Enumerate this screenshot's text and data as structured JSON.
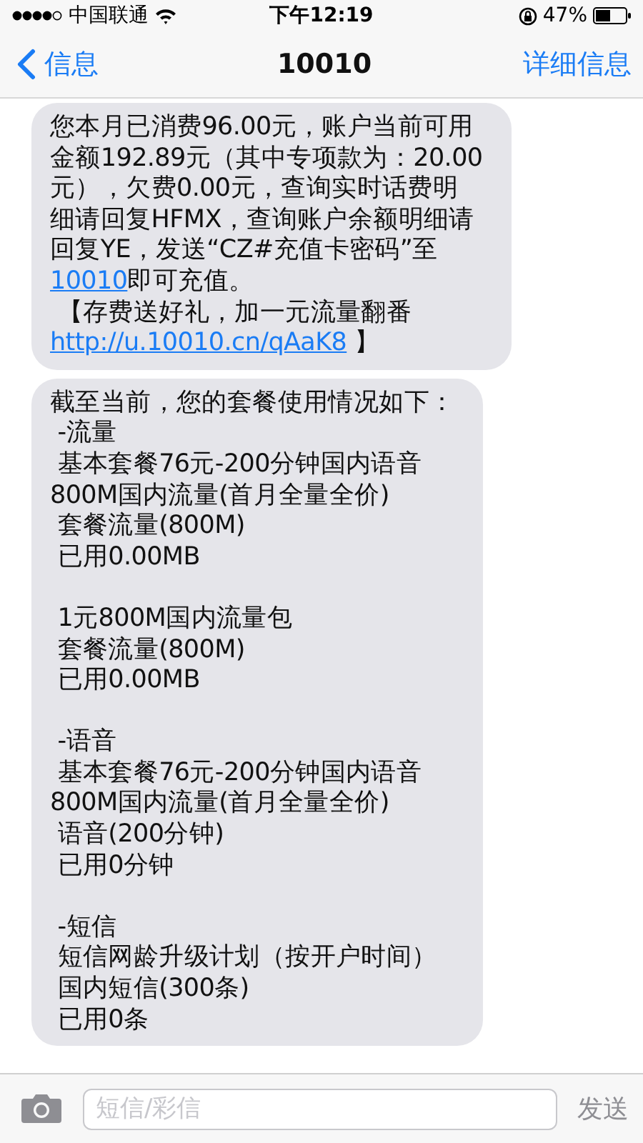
{
  "status_bar": {
    "carrier": "中国联通",
    "time": "下午12:19",
    "battery": "47%"
  },
  "nav": {
    "back": "信息",
    "title": "10010",
    "details": "详细信息"
  },
  "messages": [
    {
      "kind": "received",
      "paragraphs": [
        {
          "lines": [
            [
              {
                "kind": "text",
                "text": "您本月已消费96.00元，账户当前可用"
              }
            ],
            [
              {
                "kind": "text",
                "text": "金额192.89元（其中专项款为：20.00"
              }
            ],
            [
              {
                "kind": "text",
                "text": "元），欠费0.00元，查询实时话费明"
              }
            ],
            [
              {
                "kind": "text",
                "text": "细请回复HFMX，查询账户余额明细请"
              }
            ],
            [
              {
                "kind": "text",
                "text": "回复YE，发送“CZ#充值卡密码”至"
              }
            ],
            [
              {
                "kind": "link",
                "text": "10010"
              },
              {
                "kind": "text",
                "text": "即可充值。"
              }
            ],
            [
              {
                "kind": "text",
                "text": " 【存费送好礼，加一元流量翻番"
              }
            ],
            [
              {
                "kind": "link",
                "text": "http://u.10010.cn/qAaK8"
              },
              {
                "kind": "text",
                "text": " 】"
              }
            ]
          ]
        }
      ]
    },
    {
      "kind": "received",
      "paragraphs": [
        {
          "lines": [
            [
              {
                "kind": "text",
                "text": "截至当前，您的套餐使用情况如下："
              }
            ],
            [
              {
                "kind": "text",
                "text": " -流量"
              }
            ],
            [
              {
                "kind": "text",
                "text": " 基本套餐76元-200分钟国内语音"
              }
            ],
            [
              {
                "kind": "text",
                "text": "800M国内流量(首月全量全价)"
              }
            ],
            [
              {
                "kind": "text",
                "text": " 套餐流量(800M)"
              }
            ],
            [
              {
                "kind": "text",
                "text": " 已用0.00MB"
              }
            ]
          ]
        },
        {
          "lines": [
            [
              {
                "kind": "text",
                "text": " 1元800M国内流量包"
              }
            ],
            [
              {
                "kind": "text",
                "text": " 套餐流量(800M)"
              }
            ],
            [
              {
                "kind": "text",
                "text": " 已用0.00MB"
              }
            ]
          ]
        },
        {
          "lines": [
            [
              {
                "kind": "text",
                "text": " -语音"
              }
            ],
            [
              {
                "kind": "text",
                "text": " 基本套餐76元-200分钟国内语音"
              }
            ],
            [
              {
                "kind": "text",
                "text": "800M国内流量(首月全量全价)"
              }
            ],
            [
              {
                "kind": "text",
                "text": " 语音(200分钟)"
              }
            ],
            [
              {
                "kind": "text",
                "text": " 已用0分钟"
              }
            ]
          ]
        },
        {
          "lines": [
            [
              {
                "kind": "text",
                "text": " -短信"
              }
            ],
            [
              {
                "kind": "text",
                "text": " 短信网龄升级计划（按开户时间）"
              }
            ],
            [
              {
                "kind": "text",
                "text": " 国内短信(300条)"
              }
            ],
            [
              {
                "kind": "text",
                "text": " 已用0条"
              }
            ]
          ]
        }
      ]
    }
  ],
  "compose": {
    "placeholder": "短信/彩信",
    "send": "发送",
    "send_disabled": true
  }
}
